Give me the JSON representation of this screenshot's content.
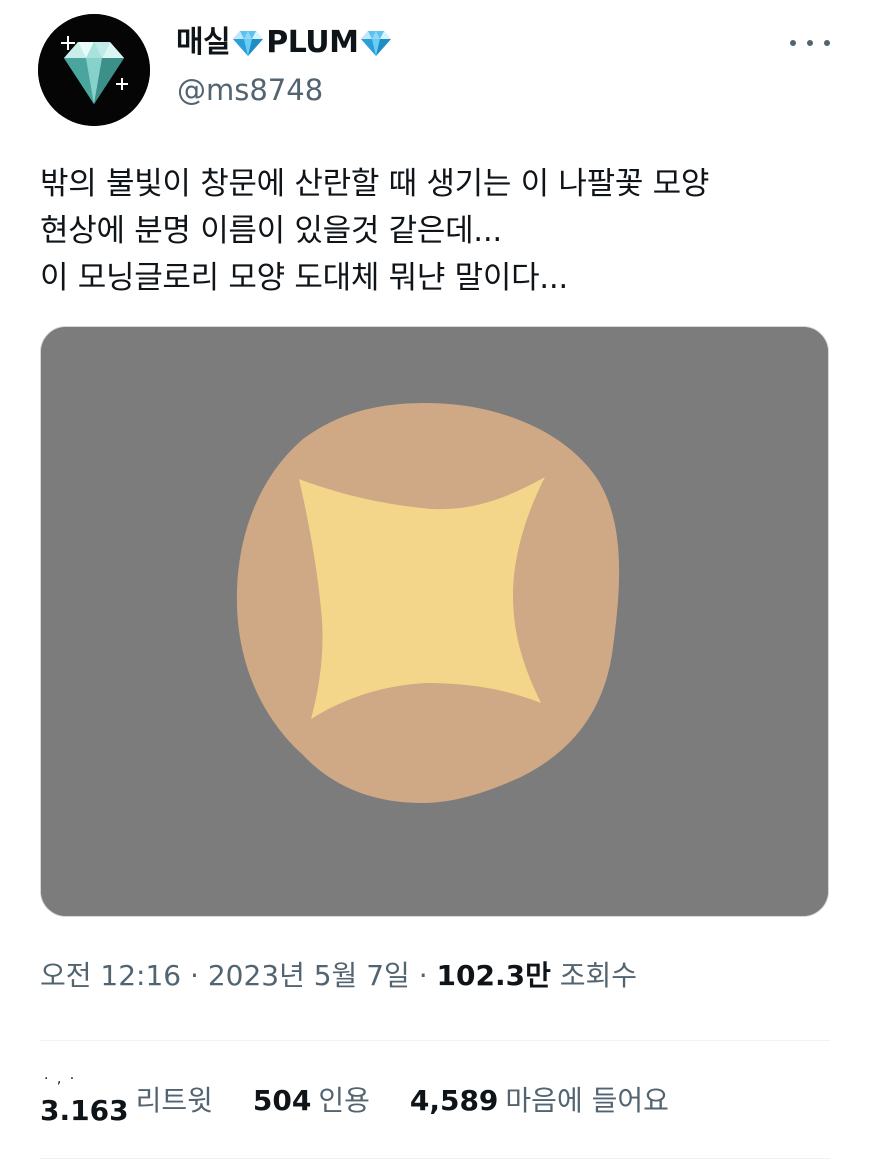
{
  "header": {
    "display_name_part1": "매실",
    "display_name_part2": "PLUM",
    "handle": "@ms8748",
    "name_icon": "diamond-icon",
    "more_icon": "more-horizontal-icon"
  },
  "tweet": {
    "lines": [
      "밖의 불빛이 창문에 산란할 때 생기는 이 나팔꽃 모양",
      "현상에 분명 이름이 있을것 같은데...",
      "이 모닝글로리 모양 도대체 뭐냔 말이다..."
    ]
  },
  "media": {
    "background_color": "#7c7c7c",
    "blob_color": "#cfa886",
    "star_color": "#f3d68a"
  },
  "meta": {
    "time": "오전 12:16",
    "separator": " · ",
    "date": "2023년 5월 7일",
    "views_count": "102.3만",
    "views_label": "조회수"
  },
  "stats": {
    "retweets_count": "3.163",
    "retweets_label": "리트윗",
    "retweets_marks": "· , ·",
    "quotes_count": "504",
    "quotes_label": "인용",
    "likes_count": "4,589",
    "likes_label": "마음에 들어요"
  },
  "colors": {
    "text_primary": "#0f1419",
    "text_secondary": "#536471",
    "divider": "#eff3f4"
  }
}
